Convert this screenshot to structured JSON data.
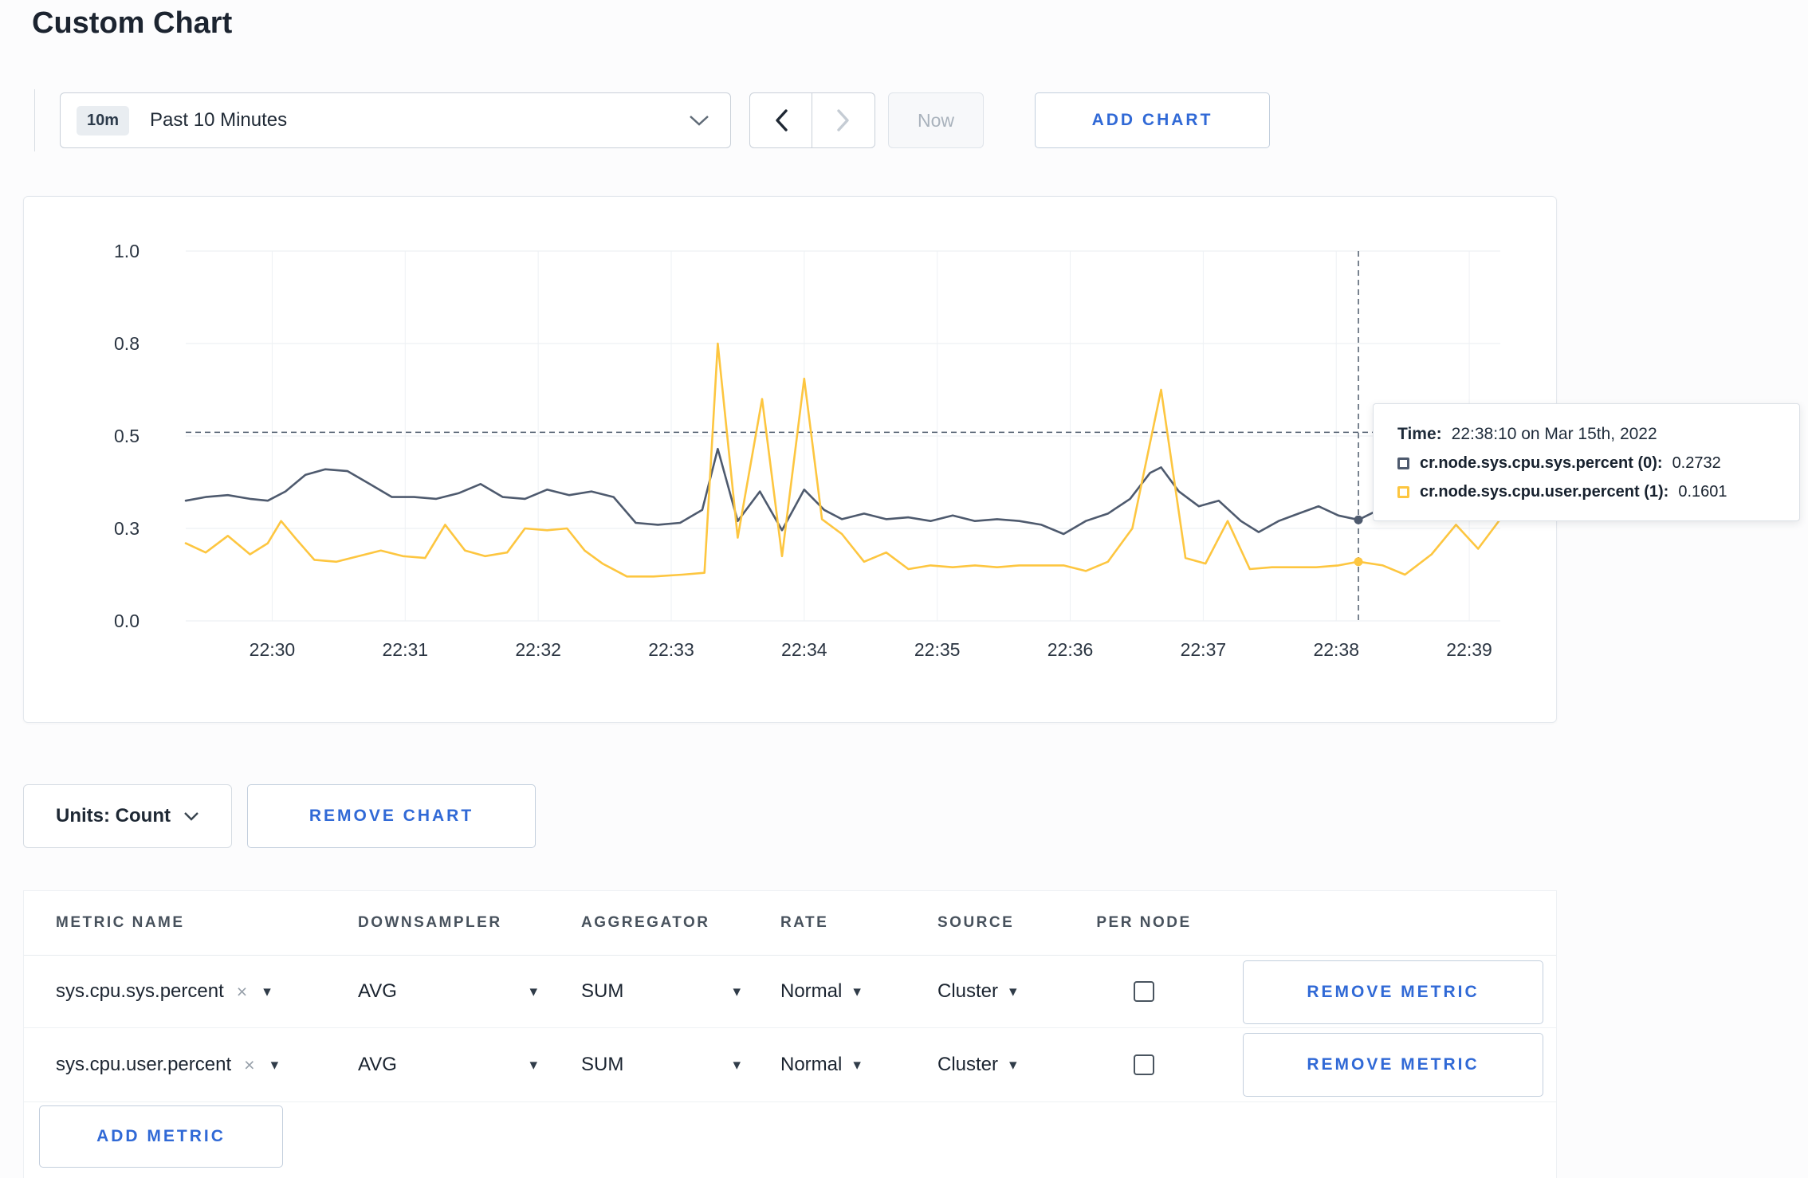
{
  "page": {
    "title": "Custom Chart"
  },
  "colors": {
    "accent_blue": "#3069d6",
    "series_sys": "#4e5a6e",
    "series_user": "#fdc640",
    "crosshair": "#4d5a6b"
  },
  "icons": {
    "chevron_down_icon": "⌄",
    "chevron_left_icon": "‹",
    "chevron_right_icon": "›",
    "caret_down_icon": "▾",
    "clear_icon": "×"
  },
  "time_controls": {
    "range_badge": "10m",
    "range_label": "Past 10 Minutes",
    "now_label": "Now",
    "add_chart_label": "ADD CHART"
  },
  "chart_controls": {
    "units_label": "Units: Count",
    "remove_chart_label": "REMOVE CHART"
  },
  "tooltip": {
    "time_label": "Time:",
    "time_value": "22:38:10 on Mar 15th, 2022",
    "series": [
      {
        "name": "cr.node.sys.cpu.sys.percent (0):",
        "value": "0.2732"
      },
      {
        "name": "cr.node.sys.cpu.user.percent (1):",
        "value": "0.1601"
      }
    ]
  },
  "metrics_table": {
    "headers": [
      "METRIC NAME",
      "DOWNSAMPLER",
      "AGGREGATOR",
      "RATE",
      "SOURCE",
      "PER NODE"
    ],
    "rows": [
      {
        "metric": "sys.cpu.sys.percent",
        "downsampler": "AVG",
        "aggregator": "SUM",
        "rate": "Normal",
        "source": "Cluster",
        "per_node_checked": false,
        "remove_label": "REMOVE METRIC"
      },
      {
        "metric": "sys.cpu.user.percent",
        "downsampler": "AVG",
        "aggregator": "SUM",
        "rate": "Normal",
        "source": "Cluster",
        "per_node_checked": false,
        "remove_label": "REMOVE METRIC"
      }
    ],
    "add_metric_label": "ADD METRIC"
  },
  "chart_data": {
    "type": "line",
    "title": "",
    "xlabel": "",
    "ylabel": "",
    "grid": true,
    "legend_position": "tooltip",
    "x_range": [
      21,
      614
    ],
    "y_range": [
      0,
      1
    ],
    "y_ticks": [
      {
        "v": 0.0,
        "label": "0.0"
      },
      {
        "v": 0.25,
        "label": "0.3"
      },
      {
        "v": 0.5,
        "label": "0.5"
      },
      {
        "v": 0.75,
        "label": "0.8"
      },
      {
        "v": 1.0,
        "label": "1.0"
      }
    ],
    "x_ticks": [
      {
        "t": 60,
        "label": "22:30"
      },
      {
        "t": 120,
        "label": "22:31"
      },
      {
        "t": 180,
        "label": "22:32"
      },
      {
        "t": 240,
        "label": "22:33"
      },
      {
        "t": 300,
        "label": "22:34"
      },
      {
        "t": 360,
        "label": "22:35"
      },
      {
        "t": 420,
        "label": "22:36"
      },
      {
        "t": 480,
        "label": "22:37"
      },
      {
        "t": 540,
        "label": "22:38"
      },
      {
        "t": 600,
        "label": "22:39"
      }
    ],
    "hover_value_line": 0.51,
    "crosshair_t": 550,
    "crosshair_time": "22:38:10",
    "series": [
      {
        "name": "cr.node.sys.cpu.sys.percent",
        "color": "#4e5a6e",
        "marker": [
          550,
          0.2732
        ],
        "points": [
          [
            21,
            0.325
          ],
          [
            30,
            0.335
          ],
          [
            40,
            0.34
          ],
          [
            50,
            0.33
          ],
          [
            58,
            0.325
          ],
          [
            66,
            0.35
          ],
          [
            75,
            0.395
          ],
          [
            84,
            0.41
          ],
          [
            94,
            0.405
          ],
          [
            104,
            0.37
          ],
          [
            114,
            0.335
          ],
          [
            124,
            0.335
          ],
          [
            134,
            0.33
          ],
          [
            144,
            0.345
          ],
          [
            154,
            0.37
          ],
          [
            164,
            0.335
          ],
          [
            174,
            0.33
          ],
          [
            184,
            0.355
          ],
          [
            194,
            0.34
          ],
          [
            204,
            0.35
          ],
          [
            214,
            0.335
          ],
          [
            224,
            0.265
          ],
          [
            234,
            0.26
          ],
          [
            244,
            0.265
          ],
          [
            254,
            0.3
          ],
          [
            261,
            0.465
          ],
          [
            270,
            0.27
          ],
          [
            280,
            0.35
          ],
          [
            290,
            0.245
          ],
          [
            300,
            0.355
          ],
          [
            309,
            0.3
          ],
          [
            317,
            0.275
          ],
          [
            327,
            0.29
          ],
          [
            337,
            0.275
          ],
          [
            347,
            0.28
          ],
          [
            357,
            0.27
          ],
          [
            367,
            0.285
          ],
          [
            377,
            0.27
          ],
          [
            387,
            0.275
          ],
          [
            397,
            0.27
          ],
          [
            407,
            0.26
          ],
          [
            417,
            0.235
          ],
          [
            427,
            0.27
          ],
          [
            437,
            0.29
          ],
          [
            447,
            0.33
          ],
          [
            456,
            0.4
          ],
          [
            461,
            0.415
          ],
          [
            469,
            0.35
          ],
          [
            478,
            0.31
          ],
          [
            487,
            0.325
          ],
          [
            497,
            0.27
          ],
          [
            505,
            0.24
          ],
          [
            514,
            0.27
          ],
          [
            523,
            0.29
          ],
          [
            532,
            0.31
          ],
          [
            541,
            0.285
          ],
          [
            550,
            0.2732
          ],
          [
            559,
            0.3
          ],
          [
            569,
            0.29
          ],
          [
            579,
            0.285
          ],
          [
            590,
            0.295
          ],
          [
            602,
            0.3
          ],
          [
            614,
            0.29
          ]
        ]
      },
      {
        "name": "cr.node.sys.cpu.user.percent",
        "color": "#fdc640",
        "marker": [
          550,
          0.1601
        ],
        "points": [
          [
            21,
            0.21
          ],
          [
            30,
            0.185
          ],
          [
            40,
            0.23
          ],
          [
            50,
            0.18
          ],
          [
            58,
            0.21
          ],
          [
            64,
            0.27
          ],
          [
            71,
            0.22
          ],
          [
            79,
            0.165
          ],
          [
            89,
            0.16
          ],
          [
            99,
            0.175
          ],
          [
            109,
            0.19
          ],
          [
            119,
            0.175
          ],
          [
            129,
            0.17
          ],
          [
            138,
            0.26
          ],
          [
            147,
            0.19
          ],
          [
            156,
            0.175
          ],
          [
            166,
            0.185
          ],
          [
            174,
            0.25
          ],
          [
            184,
            0.245
          ],
          [
            193,
            0.25
          ],
          [
            201,
            0.19
          ],
          [
            209,
            0.155
          ],
          [
            220,
            0.12
          ],
          [
            232,
            0.12
          ],
          [
            245,
            0.125
          ],
          [
            255,
            0.13
          ],
          [
            261,
            0.75
          ],
          [
            270,
            0.225
          ],
          [
            281,
            0.6
          ],
          [
            290,
            0.175
          ],
          [
            300,
            0.655
          ],
          [
            308,
            0.275
          ],
          [
            317,
            0.235
          ],
          [
            327,
            0.16
          ],
          [
            337,
            0.185
          ],
          [
            347,
            0.14
          ],
          [
            357,
            0.15
          ],
          [
            367,
            0.145
          ],
          [
            377,
            0.15
          ],
          [
            387,
            0.145
          ],
          [
            397,
            0.15
          ],
          [
            407,
            0.15
          ],
          [
            417,
            0.15
          ],
          [
            427,
            0.135
          ],
          [
            437,
            0.16
          ],
          [
            448,
            0.25
          ],
          [
            461,
            0.625
          ],
          [
            472,
            0.17
          ],
          [
            481,
            0.155
          ],
          [
            491,
            0.27
          ],
          [
            501,
            0.14
          ],
          [
            511,
            0.145
          ],
          [
            521,
            0.145
          ],
          [
            531,
            0.145
          ],
          [
            541,
            0.15
          ],
          [
            550,
            0.1601
          ],
          [
            561,
            0.15
          ],
          [
            571,
            0.125
          ],
          [
            583,
            0.18
          ],
          [
            594,
            0.26
          ],
          [
            604,
            0.195
          ],
          [
            614,
            0.275
          ]
        ]
      }
    ]
  }
}
